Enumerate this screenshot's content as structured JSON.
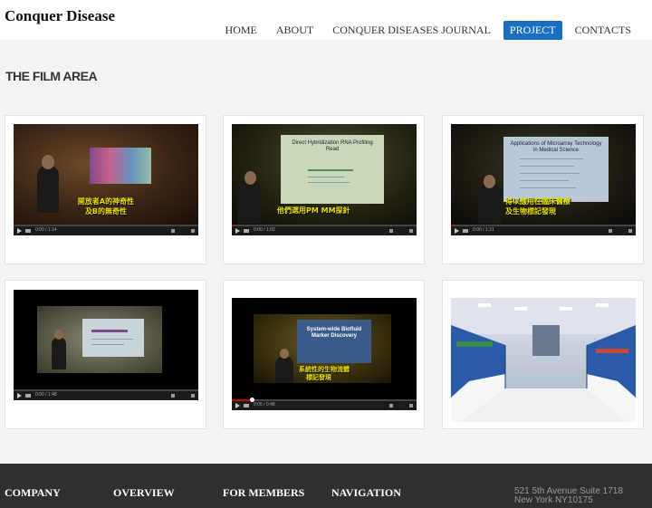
{
  "site": {
    "logo": "Conquer Disease"
  },
  "nav": [
    {
      "label": "HOME",
      "active": false
    },
    {
      "label": "ABOUT",
      "active": false
    },
    {
      "label": "CONQUER DISEASES JOURNAL",
      "active": false
    },
    {
      "label": "PROJECT",
      "active": true
    },
    {
      "label": "CONTACTS",
      "active": false
    }
  ],
  "section": {
    "title": "THE FILM AREA"
  },
  "films": [
    {
      "subtitle_1": "開放者A的神奇性",
      "subtitle_2": "及B的無奇性",
      "progress": 0.01,
      "time": "0:00 / 1:14"
    },
    {
      "slide_title": "Direct Hybridization RNA Profiling Read",
      "subtitle_1": "他們選用PM MM探針",
      "progress": 0.01,
      "time": "0:00 / 1:02"
    },
    {
      "slide_title": "Applications of Microarray Technology in Medical Science",
      "subtitle_1": "得以應用在臨床醫療",
      "subtitle_2": "及生物標記發現",
      "progress": 0.01,
      "time": "0:00 / 1:21"
    },
    {
      "progress": 0.0,
      "time": "0:00 / 1:48"
    },
    {
      "slide_title": "System-wide Biofluid Marker Discovery",
      "subtitle_1": "系統性的生物流體",
      "subtitle_2": "標記發現",
      "progress": 0.11,
      "time": "0:05 / 0:48"
    },
    {
      "image": "laboratory-photo"
    }
  ],
  "footer": {
    "columns": [
      "COMPANY",
      "OVERVIEW",
      "FOR MEMBERS",
      "NAVIGATION"
    ],
    "address_line1": "521 5th Avenue Suite 1718",
    "address_line2": "New York NY10175"
  },
  "colors": {
    "accent": "#1a6fc1",
    "footer_bg": "#2f2f2f",
    "progress": "#cc0000"
  }
}
